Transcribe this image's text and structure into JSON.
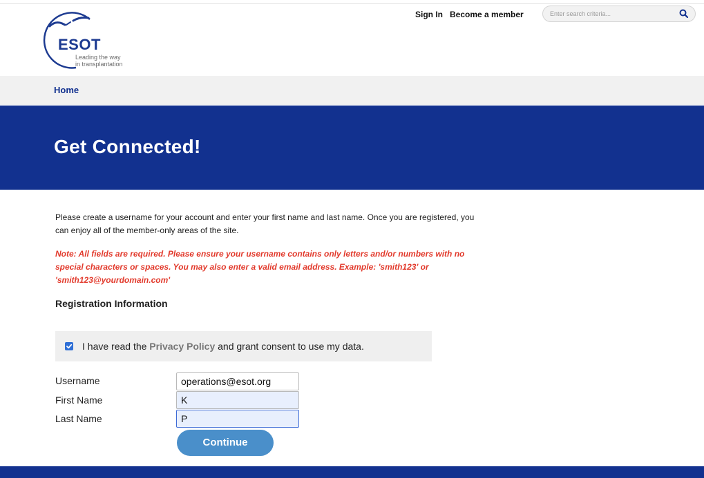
{
  "header": {
    "logo": {
      "name": "ESOT",
      "tagline_line1": "Leading the way",
      "tagline_line2": "in transplantation"
    },
    "util_nav": {
      "sign_in": "Sign In",
      "become_member": "Become a member"
    },
    "search": {
      "placeholder": "Enter search criteria..."
    }
  },
  "breadcrumb": {
    "home": "Home"
  },
  "hero": {
    "title": "Get Connected!"
  },
  "content": {
    "intro": "Please create a username for your account and enter your first name and last name. Once you are registered, you can enjoy all of the member-only areas of the site.",
    "note": "Note: All fields are required. Please ensure your username contains only letters and/or numbers with no special characters or spaces. You may also enter a valid email address. Example: 'smith123' or 'smith123@yourdomain.com'",
    "section_title": "Registration Information",
    "consent": {
      "prefix": "I have read the ",
      "link": "Privacy Policy",
      "suffix": " and grant consent to use my data.",
      "checked": true
    },
    "form": {
      "username_label": "Username",
      "username_value": "operations@esot.org",
      "first_name_label": "First Name",
      "first_name_value": "K",
      "last_name_label": "Last Name",
      "last_name_value": "P"
    },
    "continue_label": "Continue"
  },
  "colors": {
    "brand_blue": "#12318f",
    "note_red": "#e23a2c",
    "button_blue": "#4a8fca",
    "checkbox_blue": "#2f6fd6"
  }
}
